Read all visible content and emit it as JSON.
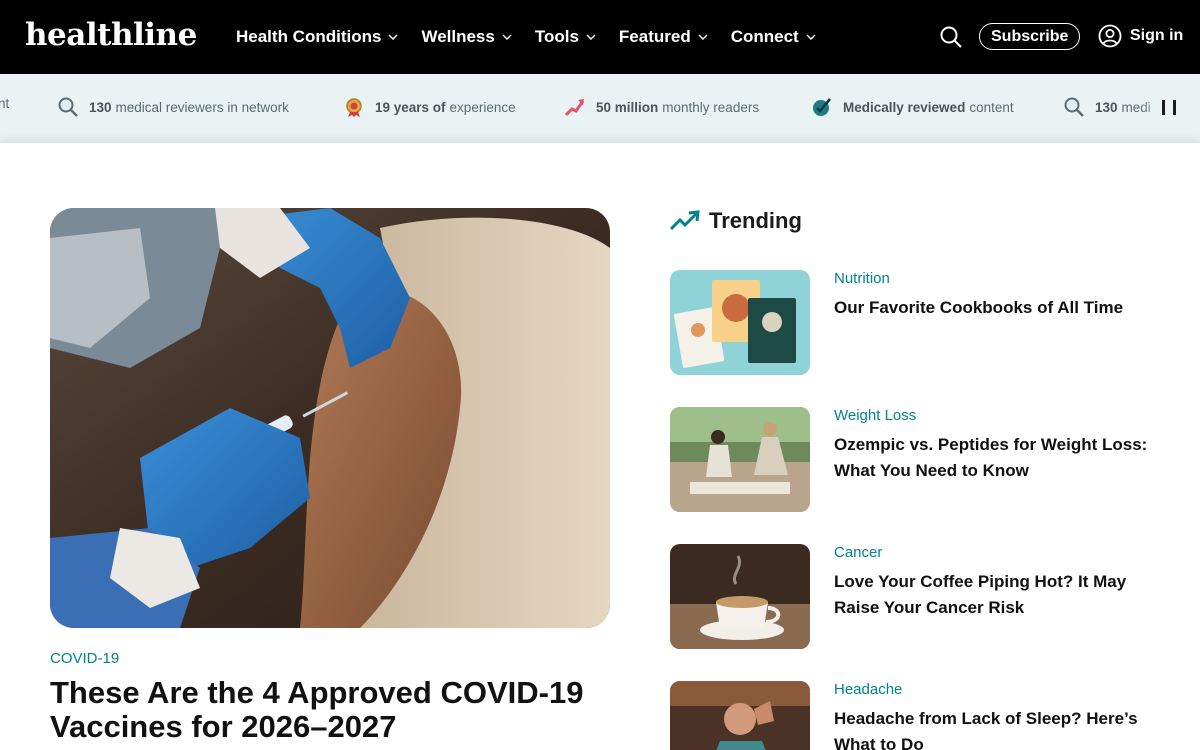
{
  "header": {
    "logo": "healthline",
    "nav": [
      {
        "label": "Health Conditions"
      },
      {
        "label": "Wellness"
      },
      {
        "label": "Tools"
      },
      {
        "label": "Featured"
      },
      {
        "label": "Connect"
      }
    ],
    "subscribe_label": "Subscribe",
    "signin_label": "Sign in"
  },
  "ticker": {
    "items": [
      {
        "bold": "",
        "text": "nt",
        "icon": "cutoff"
      },
      {
        "bold": "130",
        "text": "medical reviewers in network",
        "icon": "magnifier-icon"
      },
      {
        "bold": "19 years of",
        "text": "experience",
        "icon": "award-medal-icon"
      },
      {
        "bold": "50 million",
        "text": "monthly readers",
        "icon": "growth-arrow-icon"
      },
      {
        "bold": "Medically reviewed",
        "text": "content",
        "icon": "checkmark-badge-icon"
      },
      {
        "bold": "130",
        "text": "medi",
        "icon": "magnifier-icon"
      }
    ]
  },
  "hero": {
    "category": "COVID-19",
    "title": "These Are the 4 Approved COVID-19 Vaccines for 2026–2027",
    "image_alt": "gloved hands giving a vaccine injection in an upper arm"
  },
  "trending": {
    "heading": "Trending",
    "items": [
      {
        "category": "Nutrition",
        "title": "Our Favorite Cookbooks of All Time"
      },
      {
        "category": "Weight Loss",
        "title": "Ozempic vs. Peptides for Weight Loss: What You Need to Know"
      },
      {
        "category": "Cancer",
        "title": "Love Your Coffee Piping Hot? It May Raise Your Cancer Risk"
      },
      {
        "category": "Headache",
        "title": "Headache from Lack of Sleep? Here’s What to Do"
      }
    ]
  },
  "colors": {
    "header_bg": "#000000",
    "accent_teal": "#00838a",
    "ticker_bg": "#e9f3f4"
  }
}
